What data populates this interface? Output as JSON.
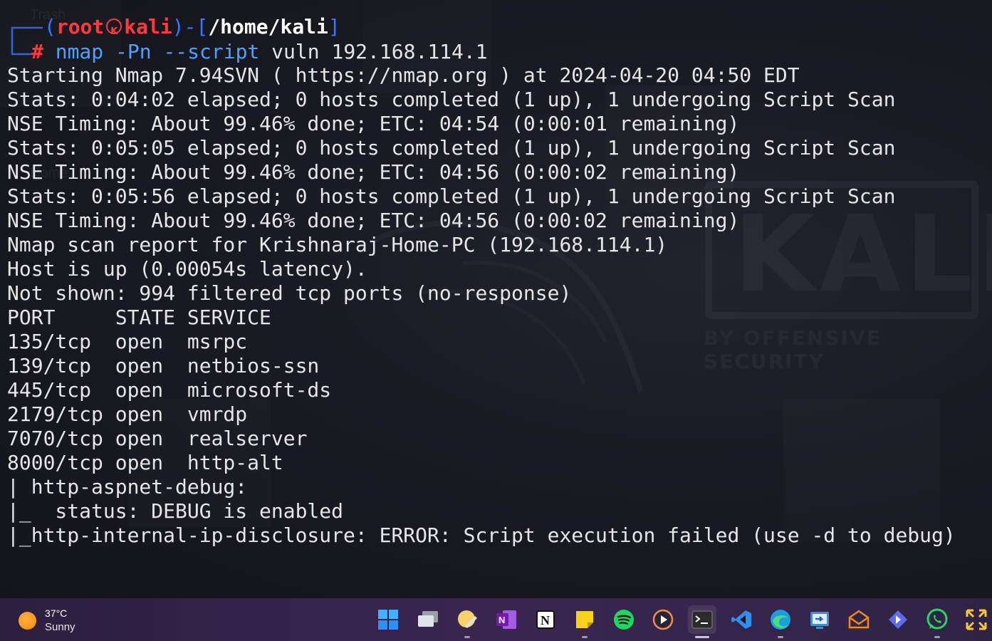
{
  "desktop": {
    "icon_labels": [
      "Trash",
      "Home"
    ],
    "wallpaper_logo": "KALI",
    "wallpaper_tagline": "BY OFFENSIVE SECURITY"
  },
  "terminal": {
    "prompt": {
      "user": "root",
      "host": "kali",
      "cwd": "/home/kali",
      "symbol": "#",
      "command_name": "nmap",
      "command_flags": "-Pn --script",
      "command_args": "vuln 192.168.114.1"
    },
    "output_lines": [
      "Starting Nmap 7.94SVN ( https://nmap.org ) at 2024-04-20 04:50 EDT",
      "Stats: 0:04:02 elapsed; 0 hosts completed (1 up), 1 undergoing Script Scan",
      "NSE Timing: About 99.46% done; ETC: 04:54 (0:00:01 remaining)",
      "Stats: 0:05:05 elapsed; 0 hosts completed (1 up), 1 undergoing Script Scan",
      "NSE Timing: About 99.46% done; ETC: 04:56 (0:00:02 remaining)",
      "Stats: 0:05:56 elapsed; 0 hosts completed (1 up), 1 undergoing Script Scan",
      "NSE Timing: About 99.46% done; ETC: 04:56 (0:00:02 remaining)",
      "Nmap scan report for Krishnaraj-Home-PC (192.168.114.1)",
      "Host is up (0.00054s latency).",
      "Not shown: 994 filtered tcp ports (no-response)",
      "PORT     STATE SERVICE",
      "135/tcp  open  msrpc",
      "139/tcp  open  netbios-ssn",
      "445/tcp  open  microsoft-ds",
      "2179/tcp open  vmrdp",
      "7070/tcp open  realserver",
      "8000/tcp open  http-alt",
      "| http-aspnet-debug:",
      "|_  status: DEBUG is enabled",
      "|_http-internal-ip-disclosure: ERROR: Script execution failed (use -d to debug)"
    ]
  },
  "taskbar": {
    "weather": {
      "temp": "37°C",
      "condition": "Sunny"
    },
    "apps": [
      {
        "name": "start-button",
        "icon": "windows-logo-icon",
        "color": "#3aa0ff"
      },
      {
        "name": "task-view",
        "icon": "task-view-icon",
        "color": "#cfd3dc"
      },
      {
        "name": "file-explorer",
        "icon": "folder-pencil-icon",
        "color": "#f5c542"
      },
      {
        "name": "onenote",
        "icon": "onenote-icon",
        "color": "#8a3ad6"
      },
      {
        "name": "notion",
        "icon": "notion-icon",
        "color": "#ffffff"
      },
      {
        "name": "sticky-notes",
        "icon": "sticky-note-icon",
        "color": "#f7d21c"
      },
      {
        "name": "spotify",
        "icon": "spotify-icon",
        "color": "#1ed760"
      },
      {
        "name": "media-player",
        "icon": "play-circle-icon",
        "color": "#f08a5d"
      },
      {
        "name": "terminal",
        "icon": "terminal-icon",
        "color": "#2b2b2b"
      },
      {
        "name": "vscode",
        "icon": "vscode-icon",
        "color": "#2d8ff0"
      },
      {
        "name": "edge",
        "icon": "edge-icon",
        "color": "#2fa7e0"
      },
      {
        "name": "remote-desktop",
        "icon": "remote-desktop-icon",
        "color": "#3e8ed0"
      },
      {
        "name": "mail",
        "icon": "mail-icon",
        "color": "#f08a1c"
      },
      {
        "name": "power-automate",
        "icon": "diamond-arrow-icon",
        "color": "#5b6cf0"
      },
      {
        "name": "whatsapp",
        "icon": "whatsapp-icon",
        "color": "#2bd366"
      },
      {
        "name": "snipping-tool",
        "icon": "expand-arrows-icon",
        "color": "#f5c542"
      }
    ]
  }
}
